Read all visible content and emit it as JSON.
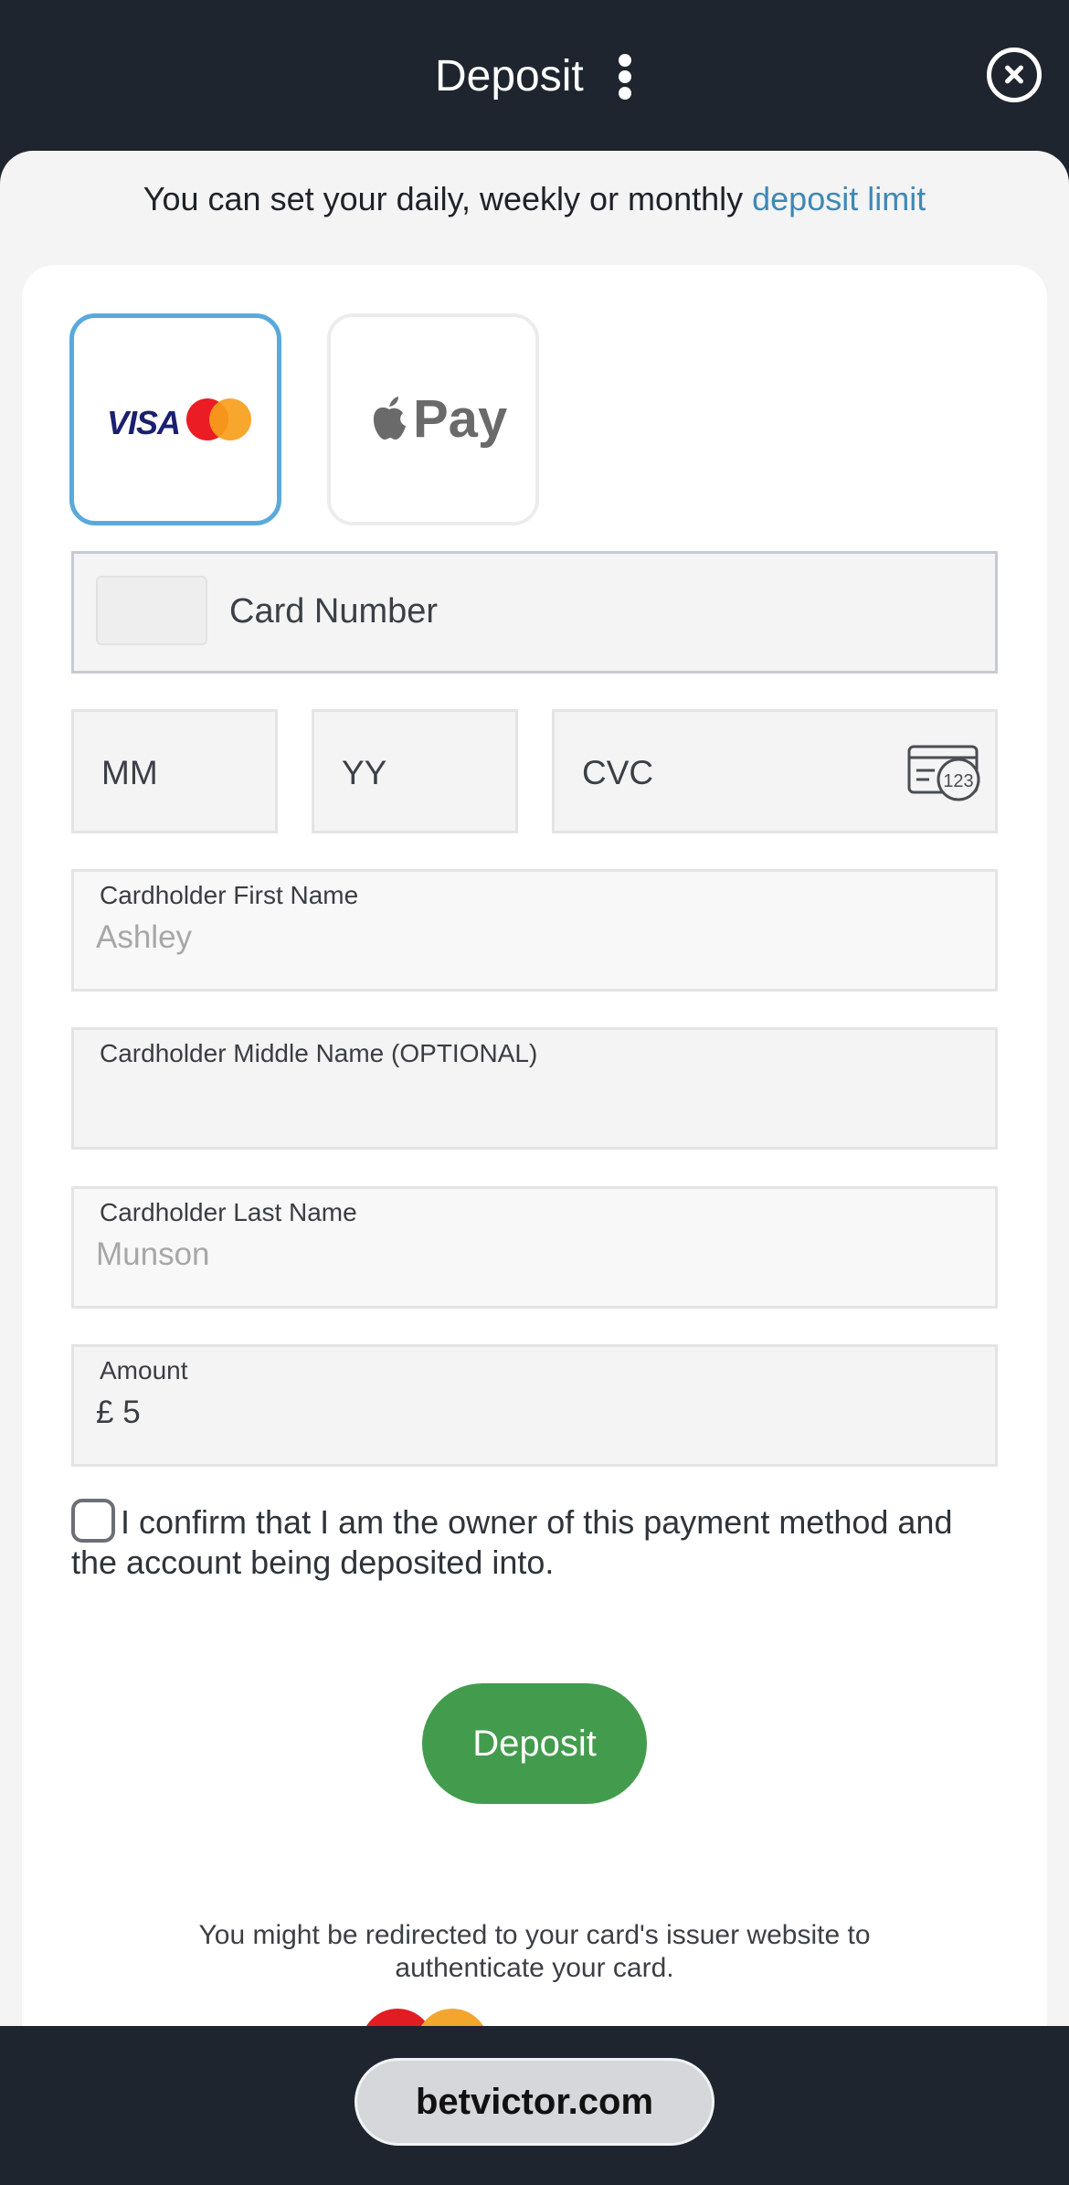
{
  "header": {
    "title": "Deposit",
    "menu_icon": "kebab-menu-icon",
    "close_icon": "close-circle-icon"
  },
  "limit_notice": {
    "text": "You can set your daily, weekly or monthly ",
    "link": "deposit limit"
  },
  "payment_methods": [
    {
      "name": "Card",
      "visa_text": "VISA",
      "selected": true
    },
    {
      "name": "Apple Pay",
      "apple_text": "Pay",
      "selected": false
    }
  ],
  "form": {
    "card_number_placeholder": "Card Number",
    "mm_placeholder": "MM",
    "yy_placeholder": "YY",
    "cvc_placeholder": "CVC",
    "cvc_icon_text": "123",
    "first_name_label": "Cardholder First Name",
    "first_name_value": "Ashley",
    "middle_name_label": "Cardholder Middle Name (OPTIONAL)",
    "middle_name_value": "",
    "last_name_label": "Cardholder Last Name",
    "last_name_value": "Munson",
    "amount_label": "Amount",
    "amount_value": "£ 5"
  },
  "confirm_text": "I confirm that I am the owner of this payment method and the account being deposited into.",
  "deposit_button": "Deposit",
  "redirect_note_line1": "You might be redirected to your card's issuer website to",
  "redirect_note_line2": "authenticate your card.",
  "browser": {
    "url": "betvictor.com"
  },
  "colors": {
    "header_bg": "#1f252e",
    "link": "#3f88b5",
    "selected_border": "#5aa9dc",
    "deposit_button": "#439c4d"
  }
}
